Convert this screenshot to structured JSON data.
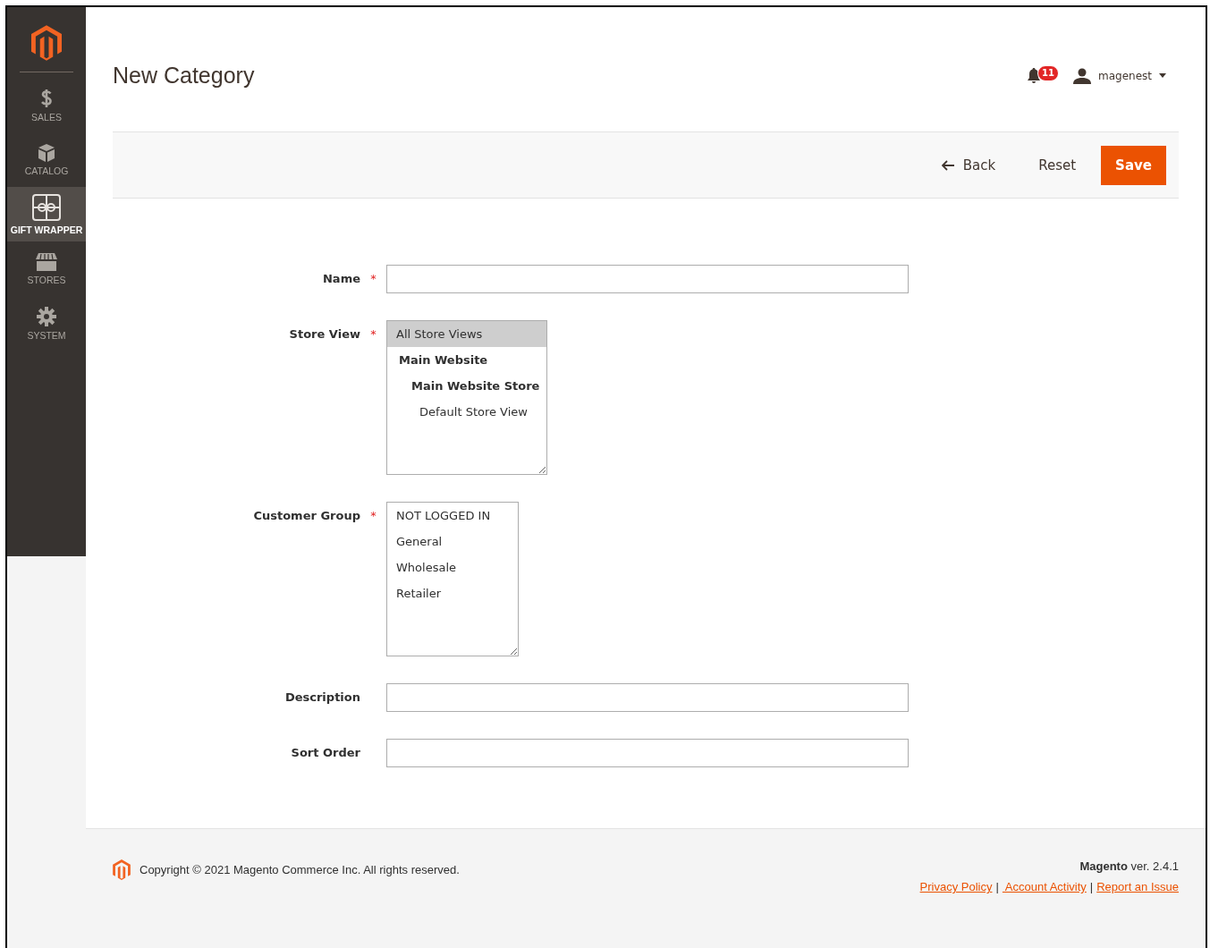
{
  "sidebar": {
    "items": [
      {
        "label": "SALES",
        "selected": false
      },
      {
        "label": "CATALOG",
        "selected": false
      },
      {
        "label": "GIFT WRAPPER",
        "selected": true
      },
      {
        "label": "STORES",
        "selected": false
      },
      {
        "label": "SYSTEM",
        "selected": false
      }
    ]
  },
  "header": {
    "title": "New Category",
    "notifications": "11",
    "user": "magenest"
  },
  "actions": [
    {
      "kind": "back",
      "label": "Back"
    },
    {
      "kind": "plain",
      "label": "Reset"
    },
    {
      "kind": "primary",
      "label": "Save"
    }
  ],
  "form": {
    "fields": [
      {
        "kind": "text",
        "label": "Name",
        "required_mark": "*"
      },
      {
        "kind": "multiselect",
        "label": "Store View",
        "required_mark": "*",
        "options": [
          {
            "label": "All Store Views",
            "selected": true
          },
          {
            "label": "Main Website",
            "selected": false,
            "children": [
              {
                "label": "Main Website Store",
                "selected": false,
                "children": [
                  {
                    "label": "Default Store View",
                    "selected": false
                  }
                ]
              }
            ]
          }
        ]
      },
      {
        "kind": "multiselect",
        "label": "Customer Group",
        "required_mark": "*",
        "options": [
          {
            "label": "NOT LOGGED IN",
            "selected": false
          },
          {
            "label": "General",
            "selected": false
          },
          {
            "label": "Wholesale",
            "selected": false
          },
          {
            "label": "Retailer",
            "selected": false
          }
        ]
      },
      {
        "kind": "text",
        "label": "Description"
      },
      {
        "kind": "text",
        "label": "Sort Order"
      }
    ]
  },
  "footer": {
    "copyright": "Copyright © 2021 Magento Commerce Inc. All rights reserved.",
    "brand": "Magento",
    "version": "ver. 2.4.1",
    "links": [
      "Privacy Policy",
      " Account Activity",
      "Report an Issue"
    ],
    "separators": [
      "|",
      "|"
    ]
  }
}
